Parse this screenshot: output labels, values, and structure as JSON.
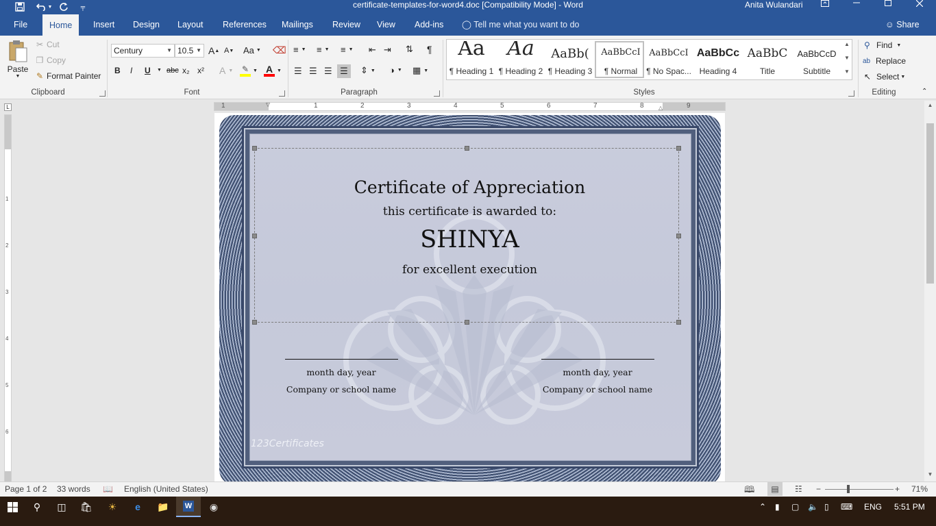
{
  "window": {
    "title": "certificate-templates-for-word4.doc [Compatibility Mode] - Word",
    "user": "Anita Wulandari",
    "controls": [
      "minimize",
      "restore",
      "close"
    ]
  },
  "quick_access": [
    "save-icon",
    "undo-icon",
    "redo-icon",
    "customize-icon"
  ],
  "tabs": [
    {
      "label": "File"
    },
    {
      "label": "Home",
      "active": true
    },
    {
      "label": "Insert"
    },
    {
      "label": "Design"
    },
    {
      "label": "Layout"
    },
    {
      "label": "References"
    },
    {
      "label": "Mailings"
    },
    {
      "label": "Review"
    },
    {
      "label": "View"
    },
    {
      "label": "Add-ins"
    }
  ],
  "tell_me": "Tell me what you want to do",
  "share": "Share",
  "clipboard": {
    "paste": "Paste",
    "cut": "Cut",
    "copy": "Copy",
    "format_painter": "Format Painter",
    "label": "Clipboard"
  },
  "font": {
    "family": "Century",
    "size": "10.5",
    "label": "Font",
    "case_label": "Aa",
    "bold": "B",
    "italic": "I",
    "underline": "U",
    "strike": "abc",
    "sub": "x₂",
    "sup": "x²",
    "grow": "A",
    "shrink": "A",
    "highlight_color": "#ffff00",
    "font_color": "#ff0000"
  },
  "paragraph": {
    "label": "Paragraph",
    "pilcrow": "¶"
  },
  "styles": {
    "label": "Styles",
    "items": [
      {
        "preview": "Aa",
        "name": "¶ Heading 1"
      },
      {
        "preview": "Aa",
        "name": "¶ Heading 2"
      },
      {
        "preview": "AaBb(",
        "name": "¶ Heading 3"
      },
      {
        "preview": "AaBbCcI",
        "name": "¶ Normal",
        "selected": true
      },
      {
        "preview": "AaBbCcI",
        "name": "¶ No Spac..."
      },
      {
        "preview": "AaBbCc",
        "name": "Heading 4"
      },
      {
        "preview": "AaBbC",
        "name": "Title"
      },
      {
        "preview": "AaBbCcD",
        "name": "Subtitle"
      }
    ]
  },
  "editing": {
    "label": "Editing",
    "find": "Find",
    "replace": "Replace",
    "select": "Select"
  },
  "ruler": {
    "marks": [
      "1",
      "1",
      "2",
      "3",
      "4",
      "5",
      "6",
      "7",
      "8",
      "9"
    ],
    "vertical_marks": [
      "1",
      "2",
      "3",
      "4",
      "5",
      "6"
    ]
  },
  "certificate": {
    "title": "Certificate of Appreciation",
    "subtitle": "this certificate is awarded to:",
    "name": "SHINYA",
    "reason": "for excellent execution",
    "left_date": "month day, year",
    "left_org": "Company or school name",
    "right_date": "month day, year",
    "right_org": "Company or school name",
    "brand": "123Certificates"
  },
  "status": {
    "page": "Page 1 of 2",
    "words": "33 words",
    "language": "English (United States)",
    "zoom": "71%",
    "zoom_level_percent": 71
  },
  "taskbar": {
    "language": "ENG",
    "time": "5:51 PM"
  }
}
